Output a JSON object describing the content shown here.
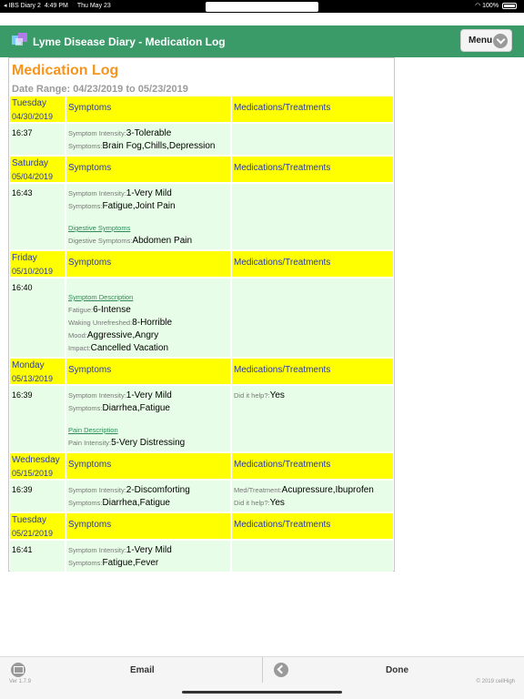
{
  "status": {
    "carrier": "◂ IBS Diary 2",
    "time": "4:49 PM",
    "date": "Thu May 23",
    "battery": "100%"
  },
  "header": {
    "title": "Lyme Disease Diary - Medication Log",
    "menu_label": "Menu"
  },
  "report": {
    "title": "Medication Log",
    "date_range": "Date Range: 04/23/2019 to 05/23/2019",
    "col_symptoms": "Symptoms",
    "col_meds": "Medications/Treatments",
    "entries": [
      {
        "day": "Tuesday",
        "date": "04/30/2019",
        "time": "16:37",
        "symptoms": [
          {
            "label": "Symptom Intensity:",
            "value": "3-Tolerable"
          },
          {
            "label": "Symptoms:",
            "value": "Brain Fog,Chills,Depression"
          }
        ],
        "meds": []
      },
      {
        "day": "Saturday",
        "date": "05/04/2019",
        "time": "16:43",
        "symptoms": [
          {
            "label": "Symptom Intensity:",
            "value": "1-Very Mild"
          },
          {
            "label": "Symptoms:",
            "value": "Fatigue,Joint Pain"
          },
          {
            "gap": true
          },
          {
            "section": "Digestive Symptoms"
          },
          {
            "label": "Digestive Symptoms:",
            "value": "Abdomen Pain"
          }
        ],
        "meds": []
      },
      {
        "day": "Friday",
        "date": "05/10/2019",
        "time": "16:40",
        "symptoms": [
          {
            "gap": true
          },
          {
            "section": "Symptom Description"
          },
          {
            "label": "Fatigue:",
            "value": "6-Intense"
          },
          {
            "label": "Waking Unrefreshed:",
            "value": "8-Horrible"
          },
          {
            "label": "Mood:",
            "value": "Aggressive,Angry"
          },
          {
            "label": "Impact:",
            "value": "Cancelled Vacation"
          }
        ],
        "meds": []
      },
      {
        "day": "Monday",
        "date": "05/13/2019",
        "time": "16:39",
        "symptoms": [
          {
            "label": "Symptom Intensity:",
            "value": "1-Very Mild"
          },
          {
            "label": "Symptoms:",
            "value": "Diarrhea,Fatigue"
          },
          {
            "gap": true
          },
          {
            "section": "Pain Description"
          },
          {
            "label": "Pain Intensity:",
            "value": "5-Very Distressing"
          }
        ],
        "meds": [
          {
            "label": "Did it help?:",
            "value": "Yes"
          }
        ]
      },
      {
        "day": "Wednesday",
        "date": "05/15/2019",
        "time": "16:39",
        "symptoms": [
          {
            "label": "Symptom Intensity:",
            "value": "2-Discomforting"
          },
          {
            "label": "Symptoms:",
            "value": "Diarrhea,Fatigue"
          }
        ],
        "meds": [
          {
            "label": "Med/Treatment:",
            "value": "Acupressure,Ibuprofen"
          },
          {
            "label": "Did it help?:",
            "value": "Yes"
          }
        ]
      },
      {
        "day": "Tuesday",
        "date": "05/21/2019",
        "time": "16:41",
        "symptoms": [
          {
            "label": "Symptom Intensity:",
            "value": "1-Very Mild"
          },
          {
            "label": "Symptoms:",
            "value": "Fatigue,Fever"
          }
        ],
        "meds": []
      }
    ]
  },
  "footer": {
    "email_label": "Email",
    "done_label": "Done",
    "version": "Ver 1.7.9",
    "copyright": "© 2019 cellHigh"
  },
  "colors": {
    "header_green": "#3a9a68",
    "title_orange": "#f7941d",
    "day_header_yellow": "#ffff00",
    "row_green": "#e8fde8",
    "header_text_blue": "#2b3aa8"
  },
  "icons": [
    "app-logo-icon",
    "chevron-down-icon",
    "mail-icon",
    "back-arrow-icon",
    "wifi-icon",
    "battery-icon"
  ]
}
